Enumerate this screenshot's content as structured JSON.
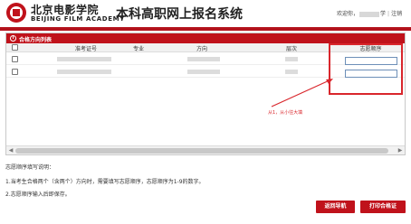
{
  "header": {
    "logo_cn": "北京电影学院",
    "logo_en": "BEIJING FILM ACADEMY",
    "system_title": "本科高职网上报名系统",
    "welcome": "欢迎你，",
    "user_suffix": "学",
    "separator": "|",
    "logout": "注销"
  },
  "panel": {
    "title": "合格方向列表",
    "columns": [
      "准考证号",
      "专业",
      "方向",
      "层次",
      "志愿顺序"
    ]
  },
  "rows": [
    {
      "preference": ""
    },
    {
      "preference": ""
    }
  ],
  "annotation": "从1，从小往大填",
  "notes": {
    "title": "志愿顺序填写说明：",
    "items": [
      "1.当考生合格两个（含两个）方向时，需要填写志愿顺序，志愿顺序为1-9的数字。",
      "2.志愿顺序输入后即保存。"
    ]
  },
  "buttons": {
    "back": "返回导航",
    "print": "打印合格证"
  },
  "colors": {
    "brand_red": "#c0121b",
    "annotation_red": "#d9262c"
  }
}
